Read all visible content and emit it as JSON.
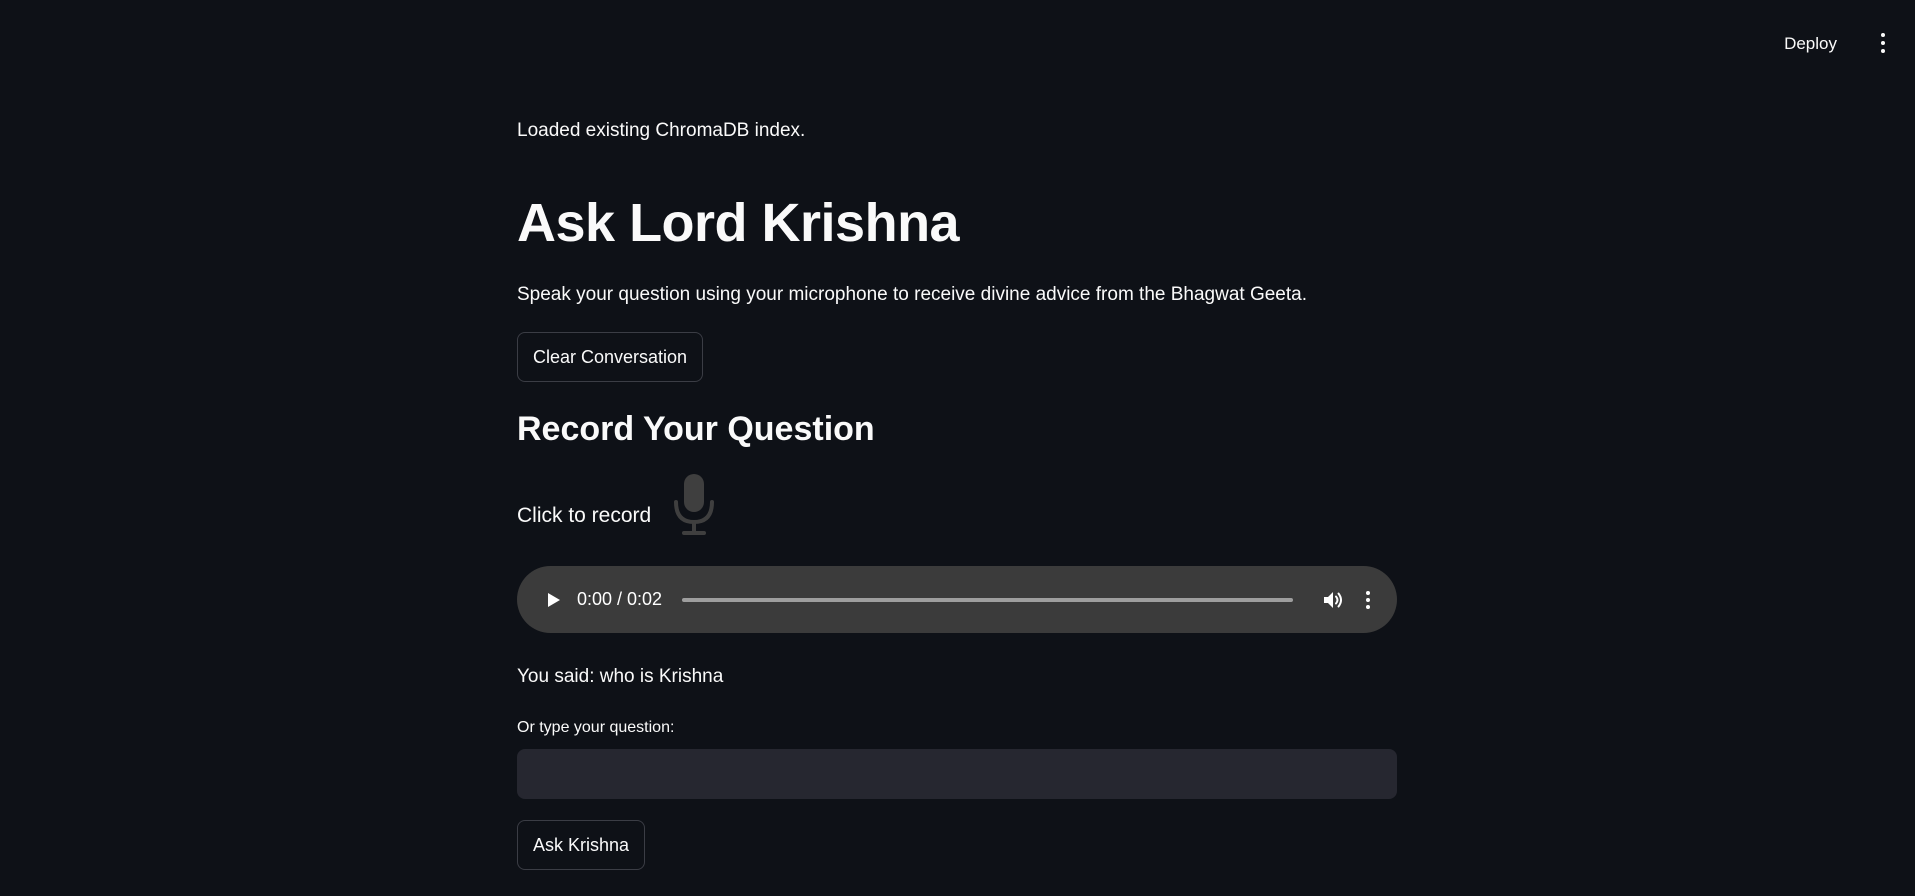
{
  "header": {
    "deploy_label": "Deploy",
    "menu_icon": "vertical-dots-icon"
  },
  "main": {
    "status": "Loaded existing ChromaDB index.",
    "title": "Ask Lord Krishna",
    "subtitle": "Speak your question using your microphone to receive divine advice from the Bhagwat Geeta.",
    "clear_button_label": "Clear Conversation",
    "record_section_title": "Record Your Question",
    "record_label": "Click to record",
    "mic_icon": "microphone-icon",
    "audio": {
      "time": "0:00 / 0:02",
      "progress": 0,
      "play_icon": "play-icon",
      "volume_icon": "volume-icon",
      "more_icon": "vertical-dots-icon"
    },
    "transcript": "You said: who is Krishna",
    "input_label": "Or type your question:",
    "input_value": "",
    "ask_button_label": "Ask Krishna"
  },
  "colors": {
    "background": "#0e1117",
    "text": "#fafafa",
    "input_bg": "#262730",
    "player_bg": "#3b3b3b",
    "mic_color": "#3f3f3f"
  }
}
